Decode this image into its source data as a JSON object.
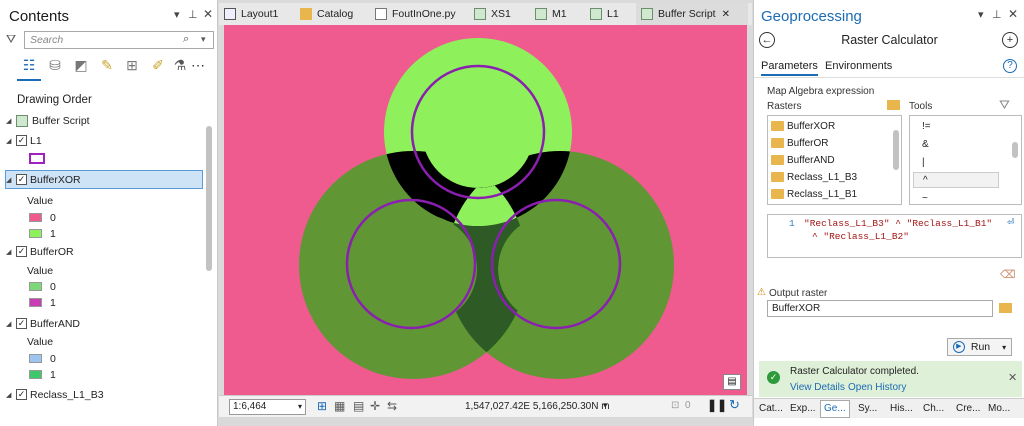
{
  "contents": {
    "title": "Contents",
    "search_placeholder": "Search",
    "drawing_order_label": "Drawing Order",
    "tree": {
      "root": "Buffer Script",
      "layers": [
        {
          "name": "L1"
        },
        {
          "name": "BufferXOR",
          "value_label": "Value",
          "classes": [
            {
              "label": "0",
              "color": "#ef5a8f"
            },
            {
              "label": "1",
              "color": "#8ef05a"
            }
          ]
        },
        {
          "name": "BufferOR",
          "value_label": "Value",
          "classes": [
            {
              "label": "0",
              "color": "#7dd87a"
            },
            {
              "label": "1",
              "color": "#c83cb4"
            }
          ]
        },
        {
          "name": "BufferAND",
          "value_label": "Value",
          "classes": [
            {
              "label": "0",
              "color": "#9cc6f0"
            },
            {
              "label": "1",
              "color": "#3ec86a"
            }
          ]
        },
        {
          "name": "Reclass_L1_B3"
        }
      ]
    }
  },
  "tabs": [
    {
      "label": "Layout1",
      "icon": "layout-icon"
    },
    {
      "label": "Catalog",
      "icon": "catalog-icon"
    },
    {
      "label": "FoutInOne.py",
      "icon": "python-file-icon"
    },
    {
      "label": "XS1",
      "icon": "map-icon"
    },
    {
      "label": "M1",
      "icon": "map-icon"
    },
    {
      "label": "L1",
      "icon": "map-icon"
    },
    {
      "label": "Buffer Script",
      "icon": "map-icon",
      "active": true
    }
  ],
  "tab_close": "✕",
  "map": {
    "background": "#ef5a8f",
    "ring_fill": "#8ef05a",
    "circle_stroke": "#8a1fb0"
  },
  "mapbar": {
    "scale": "1:6,464",
    "coordinates": "1,547,027.42E 5,166,250.30N m",
    "selected_count": "0"
  },
  "geoprocessing": {
    "title": "Geoprocessing",
    "tool_name": "Raster Calculator",
    "tab_parameters": "Parameters",
    "tab_environments": "Environments",
    "expr_label": "Map Algebra expression",
    "rasters_label": "Rasters",
    "tools_label": "Tools",
    "rasters": [
      "BufferXOR",
      "BufferOR",
      "BufferAND",
      "Reclass_L1_B3",
      "Reclass_L1_B1"
    ],
    "tools": [
      "!=",
      "&",
      "|",
      "^",
      "~"
    ],
    "expr_line_no": "1",
    "expr_line1": "\"Reclass_L1_B3\" ^ \"Reclass_L1_B1\"",
    "expr_line2": "^ \"Reclass_L1_B2\"",
    "output_label": "Output raster",
    "output_value": "BufferXOR",
    "run_label": "Run",
    "status_message": "Raster Calculator completed.",
    "view_details": "View Details",
    "open_history": "Open History",
    "bottom_tabs": [
      "Cat...",
      "Exp...",
      "Ge...",
      "Sy...",
      "His...",
      "Ch...",
      "Cre...",
      "Mo..."
    ]
  }
}
